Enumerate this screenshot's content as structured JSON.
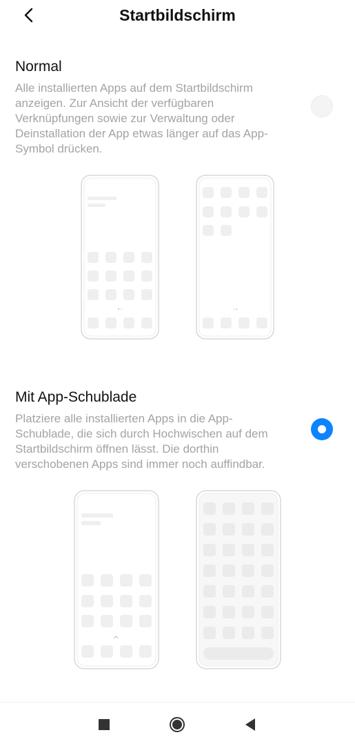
{
  "header": {
    "title": "Startbildschirm"
  },
  "options": [
    {
      "title": "Normal",
      "description": "Alle installierten Apps auf dem Startbildschirm anzeigen. Zur Ansicht der verfügbaren Verknüpfungen sowie zur Verwaltung oder Deinstallation der App etwas länger auf das App-Symbol drücken.",
      "selected": false
    },
    {
      "title": "Mit App-Schublade",
      "description": "Platziere alle installierten Apps in die App-Schublade, die sich durch Hochwischen auf dem Startbildschirm öffnen lässt. Die dorthin verschobenen Apps sind immer noch auffindbar.",
      "selected": true
    }
  ],
  "colors": {
    "accent": "#0d84ff",
    "description_text": "#a3a3a3",
    "illustration_line": "#d8d8d8",
    "illustration_fill": "#efefef"
  },
  "icons": {
    "back": "chevron-left-icon",
    "nav_recents": "square-icon",
    "nav_home": "circle-icon",
    "nav_back": "triangle-left-icon"
  }
}
